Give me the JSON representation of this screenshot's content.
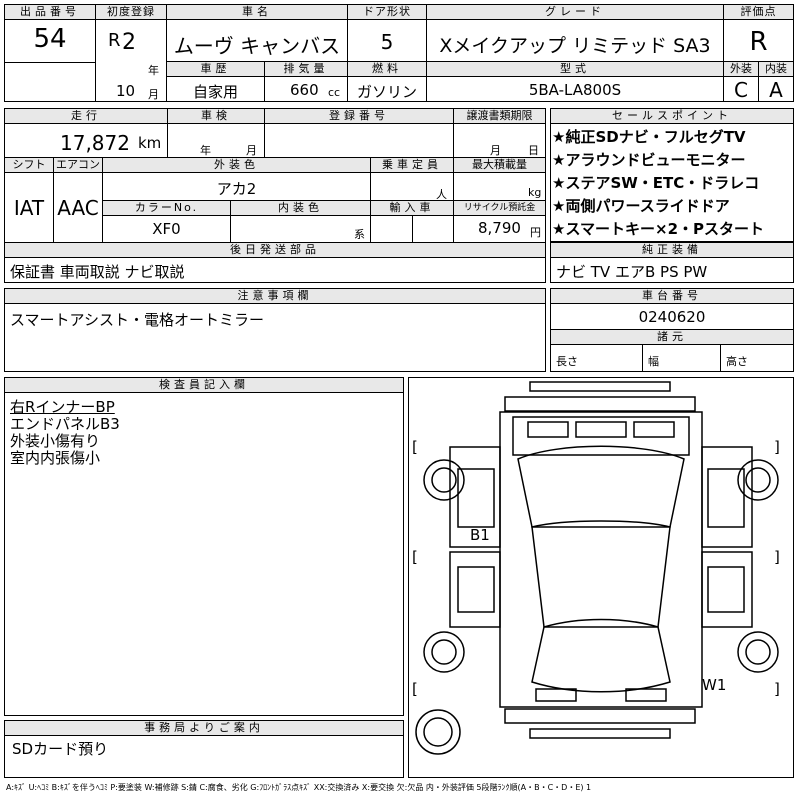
{
  "lot": {
    "label": "出品番号",
    "value": "54"
  },
  "first_reg": {
    "label": "初度登録",
    "era": "R",
    "year": "2",
    "year_unit": "年",
    "month": "10",
    "month_unit": "月"
  },
  "car_name": {
    "label": "車名",
    "value": "ムーヴ キャンバス"
  },
  "door": {
    "label": "ドア形状",
    "value": "5"
  },
  "grade": {
    "label": "グレード",
    "value": "Xメイクアップ リミテッド SA3"
  },
  "score": {
    "label": "評価点",
    "value": "R"
  },
  "history": {
    "label": "車歴",
    "value": "自家用"
  },
  "displacement": {
    "label": "排気量",
    "value": "660",
    "unit": "cc"
  },
  "fuel": {
    "label": "燃料",
    "value": "ガソリン"
  },
  "model": {
    "label": "型式",
    "value": "5BA-LA800S"
  },
  "exterior_grade": {
    "label": "外装",
    "value": "C"
  },
  "interior_grade": {
    "label": "内装",
    "value": "A"
  },
  "mileage": {
    "label": "走行",
    "value": "17,872",
    "unit": "km"
  },
  "inspection": {
    "label": "車検",
    "year_unit": "年",
    "month_unit": "月"
  },
  "reg_no": {
    "label": "登録番号"
  },
  "transfer": {
    "label": "譲渡書類期限",
    "month_unit": "月",
    "day_unit": "日"
  },
  "shift": {
    "label": "シフト",
    "value": "IAT"
  },
  "aircon": {
    "label": "エアコン",
    "value": "AAC"
  },
  "ext_color": {
    "label": "外装色",
    "value": "アカ2"
  },
  "capacity": {
    "label": "乗車定員",
    "unit": "人"
  },
  "max_load": {
    "label": "最大積載量",
    "unit": "kg"
  },
  "color_no": {
    "label": "カラーNo.",
    "value": "XF0"
  },
  "int_color": {
    "label": "内装色",
    "unit": "系"
  },
  "import": {
    "label": "輸入車"
  },
  "recycle": {
    "label": "リサイクル預託金",
    "value": "8,790",
    "unit": "円"
  },
  "sales_points": {
    "label": "セールスポイント",
    "items": [
      "★純正SDナビ・フルセグTV",
      "★アラウンドビューモニター",
      "★ステアSW・ETC・ドラレコ",
      "★両側パワースライドドア",
      "★スマートキー×2・Pスタート"
    ]
  },
  "later_parts": {
    "label": "後日発送部品",
    "value": "保証書 車両取説 ナビ取説"
  },
  "equipment": {
    "label": "純正装備",
    "value": "ナビ TV エアB PS PW"
  },
  "notes": {
    "label": "注意事項欄",
    "value": "スマートアシスト・電格オートミラー"
  },
  "chassis": {
    "label": "車台番号",
    "value": "0240620"
  },
  "dims": {
    "label": "諸元",
    "length": "長さ",
    "width": "幅",
    "height": "高さ"
  },
  "inspector": {
    "label": "検査員記入欄",
    "lines": [
      "右RインナーBP",
      "エンドパネルB3",
      "外装小傷有り",
      "室内内張傷小"
    ]
  },
  "diagram": {
    "mark_b1": "B1",
    "mark_w1": "W1",
    "bracket_l": "[",
    "bracket_r": "]"
  },
  "office": {
    "label": "事務局よりご案内",
    "value": "SDカード預り"
  },
  "legend": "A:ｷｽﾞ U:ﾍｺﾐ B:ｷｽﾞを伴うﾍｺﾐ P:要塗装 W:補修跡 S:錆 C:腐食、劣化 G:ﾌﾛﾝﾄｶﾞﾗｽ点ｷｽﾞ XX:交換済み X:要交換 欠:欠品 内・外装評価 5段階ﾗﾝｸ順(A・B・C・D・E) 1"
}
